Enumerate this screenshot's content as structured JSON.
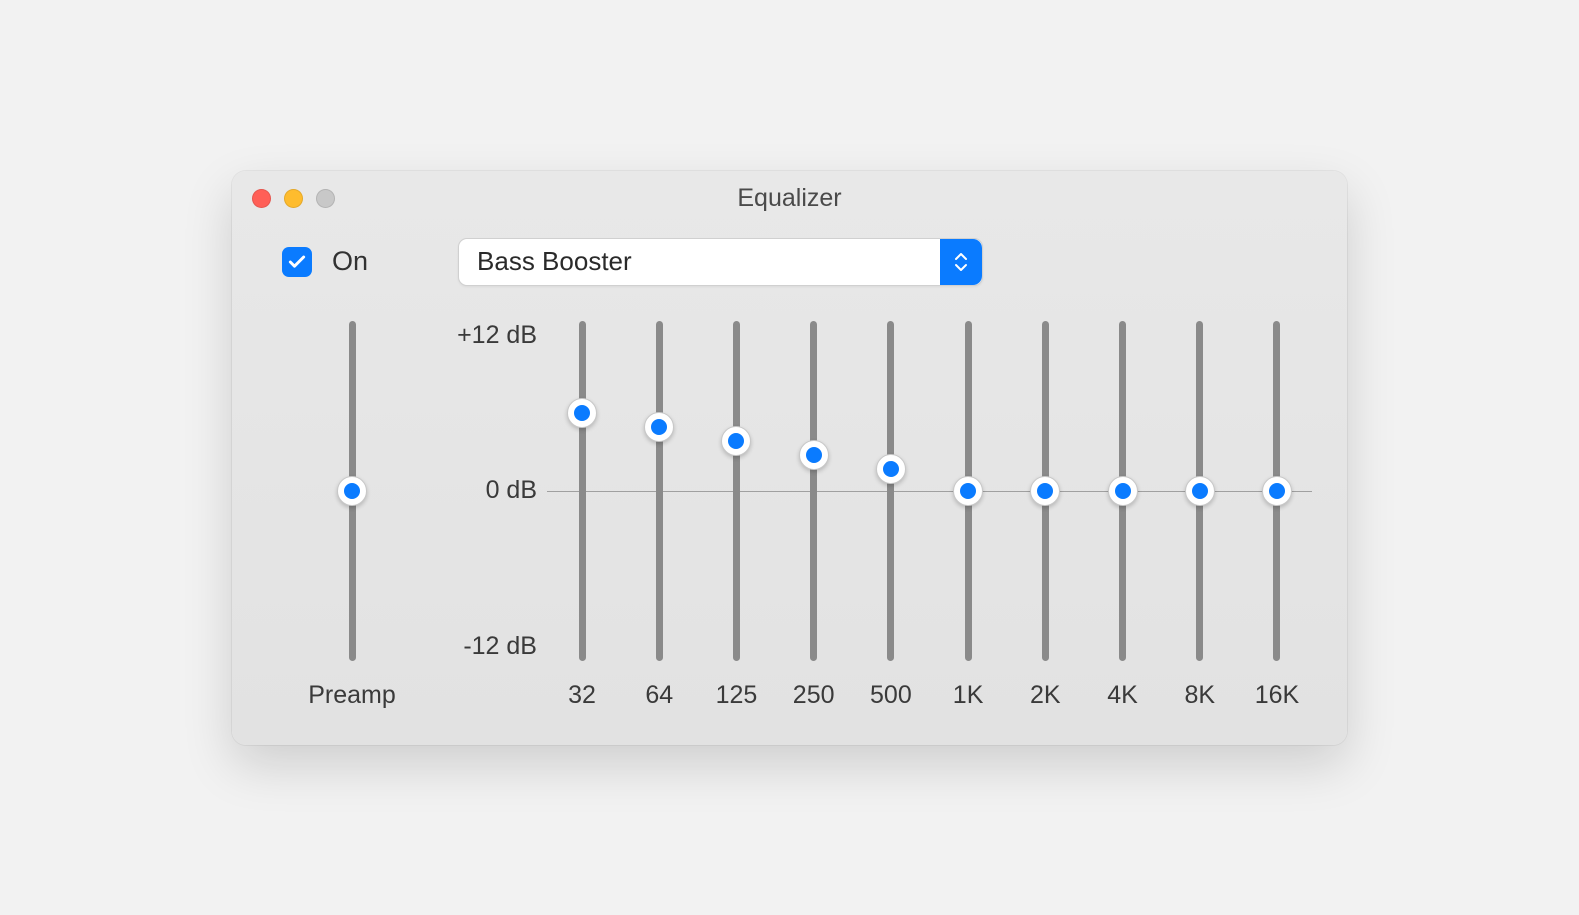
{
  "window": {
    "title": "Equalizer"
  },
  "checkbox": {
    "checked": true,
    "label": "On"
  },
  "preset": {
    "selected": "Bass Booster"
  },
  "db_labels": {
    "max": "+12 dB",
    "mid": "0 dB",
    "min": "-12 dB"
  },
  "preamp": {
    "label": "Preamp",
    "value_db": 0
  },
  "bands": [
    {
      "freq": "32",
      "value_db": 5.5
    },
    {
      "freq": "64",
      "value_db": 4.5
    },
    {
      "freq": "125",
      "value_db": 3.5
    },
    {
      "freq": "250",
      "value_db": 2.5
    },
    {
      "freq": "500",
      "value_db": 1.5
    },
    {
      "freq": "1K",
      "value_db": 0
    },
    {
      "freq": "2K",
      "value_db": 0
    },
    {
      "freq": "4K",
      "value_db": 0
    },
    {
      "freq": "8K",
      "value_db": 0
    },
    {
      "freq": "16K",
      "value_db": 0
    }
  ],
  "range": {
    "min": -12,
    "max": 12
  }
}
